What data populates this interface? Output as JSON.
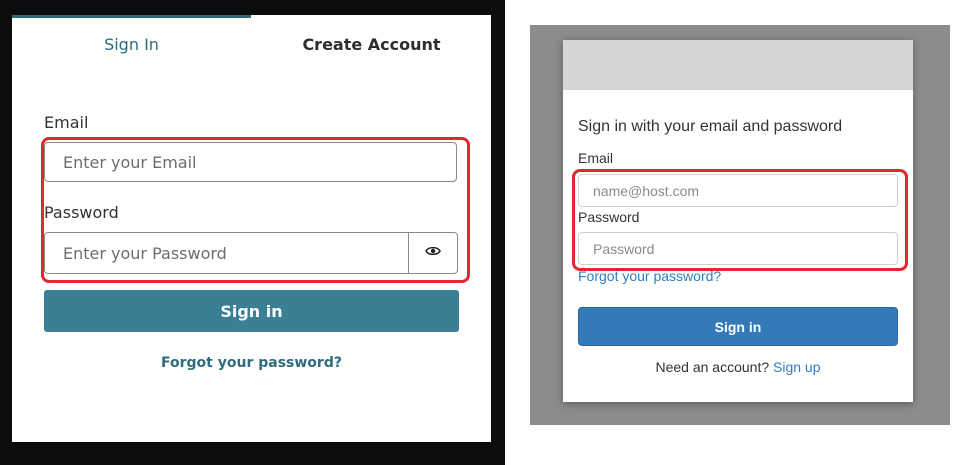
{
  "left": {
    "tabs": {
      "signin": "Sign In",
      "create": "Create Account"
    },
    "email": {
      "label": "Email",
      "placeholder": "Enter your Email"
    },
    "password": {
      "label": "Password",
      "placeholder": "Enter your Password"
    },
    "signin_button": "Sign in",
    "forgot_link": "Forgot your password?"
  },
  "right": {
    "heading": "Sign in with your email and password",
    "email": {
      "label": "Email",
      "placeholder": "name@host.com"
    },
    "password": {
      "label": "Password",
      "placeholder": "Password"
    },
    "forgot_link": "Forgot your password?",
    "signin_button": "Sign in",
    "need_account": "Need an account?",
    "signup_link": "Sign up"
  },
  "colors": {
    "left_accent": "#3a7f93",
    "right_accent": "#337ab7",
    "highlight": "#e0282e"
  }
}
